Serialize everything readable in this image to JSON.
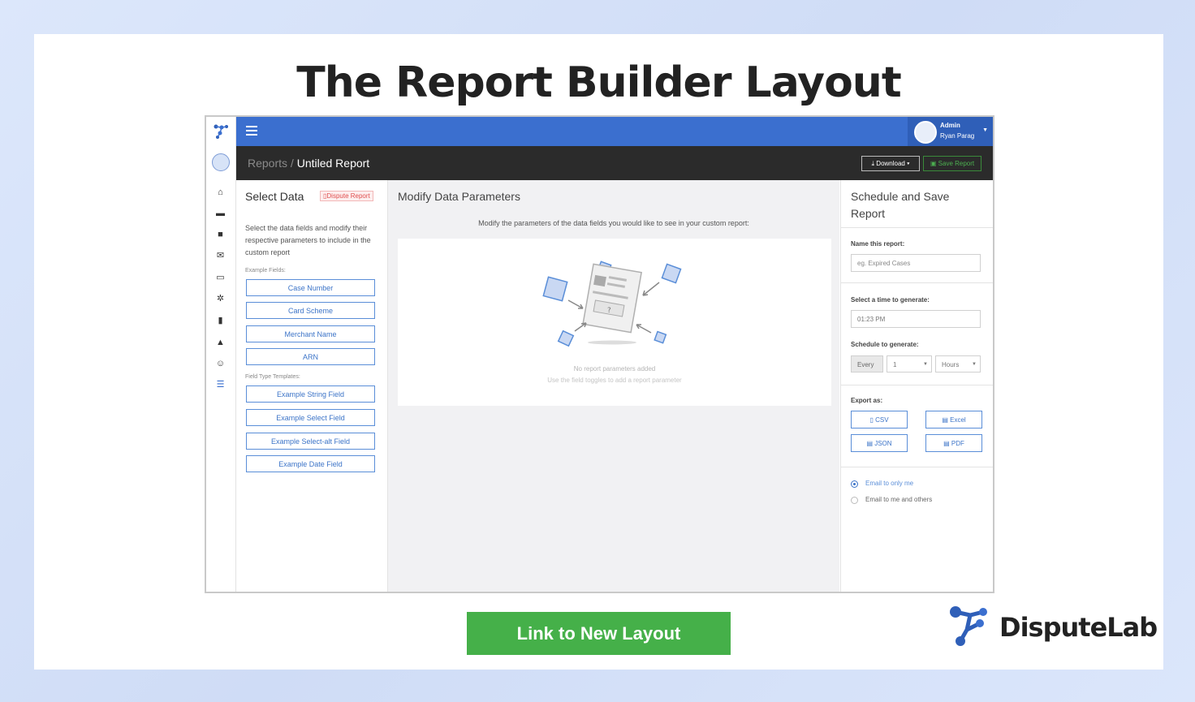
{
  "headline": "The Report Builder Layout",
  "topbar": {
    "user_role": "Admin",
    "user_name": "Ryan Parag"
  },
  "breadcrumb": {
    "parent": "Reports",
    "separator": "/",
    "current": "Untiled Report"
  },
  "actions": {
    "download_label": "Download",
    "save_label": "Save Report"
  },
  "select_data": {
    "title": "Select Data",
    "tag": "Dispute Report",
    "description": "Select the data fields and modify their respective parameters to include in the custom report",
    "example_fields_label": "Example Fields:",
    "example_fields": [
      "Case Number",
      "Card Scheme",
      "Merchant Name",
      "ARN"
    ],
    "templates_label": "Field Type Templates:",
    "templates": [
      "Example String Field",
      "Example Select Field",
      "Example Select-alt Field",
      "Example Date Field"
    ]
  },
  "modify": {
    "title": "Modify Data Parameters",
    "subtitle": "Modify the parameters of the data fields you would like to see in your custom report:",
    "empty_title": "No report parameters added",
    "empty_hint": "Use the field toggles to add a report parameter"
  },
  "schedule": {
    "title": "Schedule and Save Report",
    "name_label": "Name this report:",
    "name_placeholder": "eg. Expired Cases",
    "time_label": "Select a time to generate:",
    "time_value": "01:23 PM",
    "schedule_label": "Schedule to generate:",
    "every_label": "Every",
    "interval_value": "1",
    "unit_value": "Hours",
    "export_label": "Export as:",
    "export_csv": "CSV",
    "export_excel": "Excel",
    "export_json": "JSON",
    "export_pdf": "PDF",
    "email_only_me": "Email to only me",
    "email_others": "Email to me and others",
    "email_selected": "only_me"
  },
  "cta": {
    "label": "Link to New Layout"
  },
  "brand": {
    "name": "DisputeLab"
  },
  "colors": {
    "primary": "#3b6fcf",
    "dark_bar": "#2b2b2b",
    "cta_green": "#45b049",
    "danger_tag": "#e05050"
  }
}
